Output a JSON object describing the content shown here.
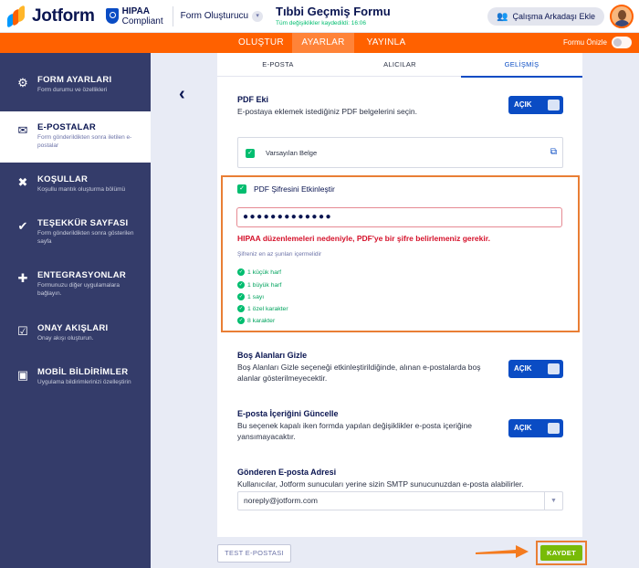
{
  "header": {
    "logo_text": "Jotform",
    "hipaa_line1": "HIPAA",
    "hipaa_line2": "Compliant",
    "form_creator": "Form Oluşturucu",
    "form_title": "Tıbbi Geçmiş Formu",
    "saved_note": "Tüm değişiklikler kaydedildi: 16:06",
    "add_colleague": "Çalışma Arkadaşı Ekle"
  },
  "nav": {
    "tabs": [
      "OLUŞTUR",
      "AYARLAR",
      "YAYINLA"
    ],
    "active": "AYARLAR",
    "preview_label": "Formu Önizle"
  },
  "sidebar": {
    "items": [
      {
        "title": "FORM AYARLARI",
        "desc": "Form durumu ve özellikleri",
        "icon": "gear-icon"
      },
      {
        "title": "E-POSTALAR",
        "desc": "Form gönderildikten sonra iletilen e-postalar",
        "icon": "envelope-icon"
      },
      {
        "title": "KOŞULLAR",
        "desc": "Koşullu mantık oluşturma bölümü",
        "icon": "shuffle-icon"
      },
      {
        "title": "TEŞEKKÜR SAYFASI",
        "desc": "Form gönderildikten sonra gösterilen sayfa",
        "icon": "check-circle-icon"
      },
      {
        "title": "ENTEGRASYONLAR",
        "desc": "Formunuzu diğer uygulamalara bağlayın.",
        "icon": "puzzle-icon"
      },
      {
        "title": "ONAY AKIŞLARI",
        "desc": "Onay akışı oluşturun.",
        "icon": "approval-icon"
      },
      {
        "title": "MOBİL BİLDİRİMLER",
        "desc": "Uygulama bildirimlerinizi özelleştirin",
        "icon": "mobile-bell-icon"
      }
    ],
    "active_index": 1
  },
  "subtabs": {
    "items": [
      "E-POSTA",
      "ALICILAR",
      "GELİŞMİŞ"
    ],
    "active": "GELİŞMİŞ"
  },
  "pdf_attachment": {
    "title": "PDF Eki",
    "desc": "E-postaya eklemek istediğiniz PDF belgelerini seçin.",
    "toggle": "AÇIK",
    "default_doc": "Varsayılan Belge"
  },
  "pdf_password": {
    "checkbox_label": "PDF Şifresini Etkinleştir",
    "masked_value": "●●●●●●●●●●●●●",
    "error": "HIPAA düzenlemeleri nedeniyle, PDF'ye bir şifre belirlemeniz gerekir.",
    "hint": "Şifreniz en az şunları içermelidir",
    "rules": [
      "1 küçük harf",
      "1 büyük harf",
      "1 sayı",
      "1 özel karakter",
      "8 karakter"
    ]
  },
  "hide_empty": {
    "title": "Boş Alanları Gizle",
    "desc": "Boş Alanları Gizle seçeneği etkinleştirildiğinde, alınan e-postalarda boş alanlar gösterilmeyecektir.",
    "toggle": "AÇIK"
  },
  "update_content": {
    "title": "E-posta İçeriğini Güncelle",
    "desc": "Bu seçenek kapalı iken formda yapılan değişiklikler e-posta içeriğine yansımayacaktır.",
    "toggle": "AÇIK"
  },
  "sender": {
    "title": "Gönderen E-posta Adresi",
    "desc": "Kullanıcılar, Jotform sunucuları yerine sizin SMTP sunucunuzdan e-posta alabilirler.",
    "value": "noreply@jotform.com"
  },
  "footer": {
    "test_button": "TEST E-POSTASI",
    "save_button": "KAYDET"
  },
  "colors": {
    "orange": "#ff6100",
    "navy": "#0a1551",
    "blue": "#0a4cc4",
    "sidebar": "#343c6a",
    "green": "#01bd6f",
    "save_green": "#78bb07",
    "error_red": "#d5122b"
  }
}
